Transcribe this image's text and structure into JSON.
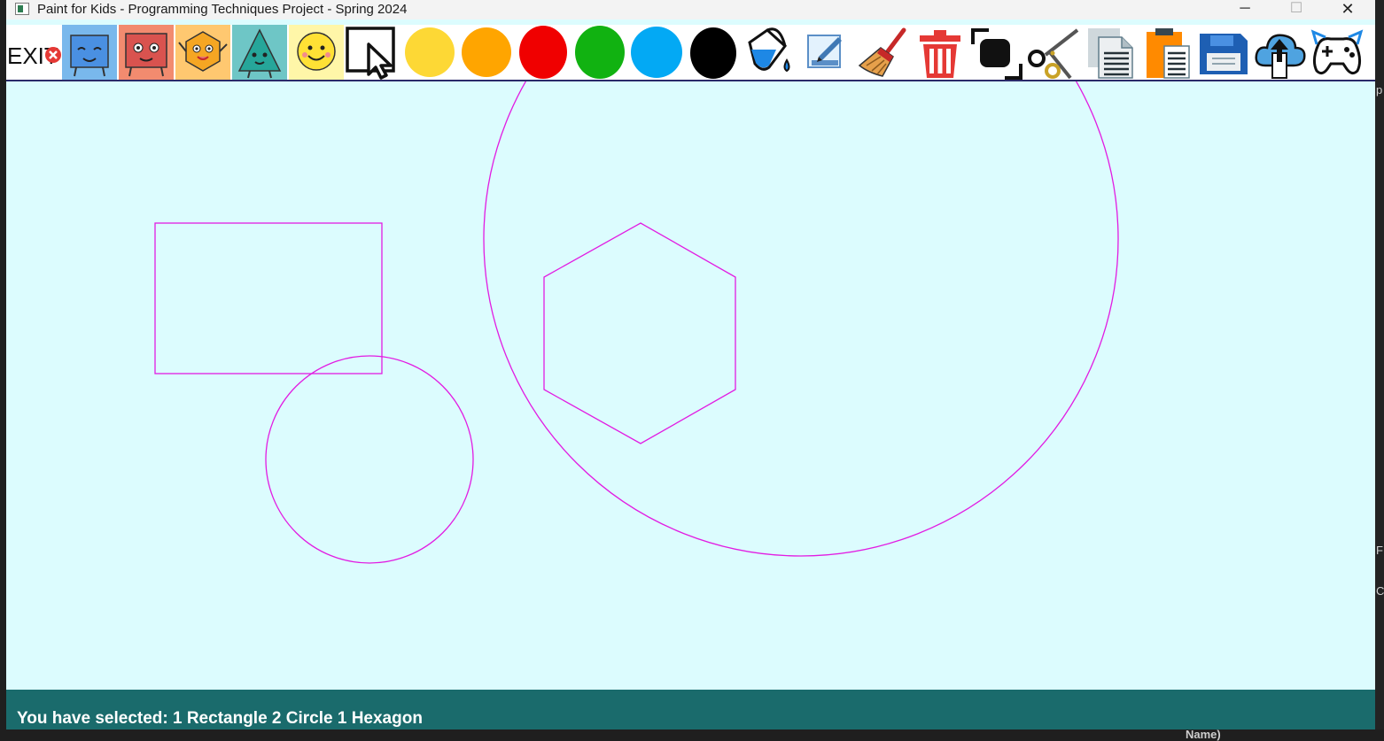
{
  "window": {
    "title": "Paint for Kids - Programming Techniques Project - Spring 2024",
    "minimize_glyph": "─",
    "maximize_glyph": "☐",
    "close_glyph": "✕"
  },
  "toolbar": {
    "exit_label": "EXIT",
    "items": [
      {
        "name": "exit",
        "icon": "exit-icon"
      },
      {
        "name": "square",
        "icon": "square-character-icon"
      },
      {
        "name": "rectangle",
        "icon": "rectangle-character-icon"
      },
      {
        "name": "hexagon",
        "icon": "hexagon-character-icon"
      },
      {
        "name": "triangle",
        "icon": "triangle-character-icon"
      },
      {
        "name": "circle",
        "icon": "circle-character-icon"
      },
      {
        "name": "select",
        "icon": "cursor-icon"
      },
      {
        "name": "yellow",
        "icon": "yellow-color-icon",
        "color": "#fdd835"
      },
      {
        "name": "orange",
        "icon": "orange-color-icon",
        "color": "#ffa500"
      },
      {
        "name": "red",
        "icon": "red-color-icon",
        "color": "#f00000"
      },
      {
        "name": "green",
        "icon": "green-color-icon",
        "color": "#11b211"
      },
      {
        "name": "blue",
        "icon": "blue-color-icon",
        "color": "#03a9f4"
      },
      {
        "name": "black",
        "icon": "black-color-icon",
        "color": "#000000"
      },
      {
        "name": "fill",
        "icon": "paint-bucket-icon"
      },
      {
        "name": "edit",
        "icon": "edit-pencil-icon"
      },
      {
        "name": "clear",
        "icon": "broom-icon"
      },
      {
        "name": "delete",
        "icon": "trash-icon"
      },
      {
        "name": "copy",
        "icon": "copy-icon"
      },
      {
        "name": "cut",
        "icon": "scissors-icon"
      },
      {
        "name": "paste",
        "icon": "document-icon"
      },
      {
        "name": "clipboard",
        "icon": "clipboard-icon"
      },
      {
        "name": "save",
        "icon": "floppy-disk-icon"
      },
      {
        "name": "load",
        "icon": "cloud-upload-icon"
      },
      {
        "name": "play",
        "icon": "gamepad-icon"
      }
    ]
  },
  "canvas": {
    "background": "#dcfcfe",
    "shape_color": "#e21be2",
    "shapes": [
      {
        "type": "rectangle"
      },
      {
        "type": "circle"
      },
      {
        "type": "circle"
      },
      {
        "type": "hexagon"
      }
    ]
  },
  "status": {
    "text": "You have selected: 1  Rectangle 2  Circle 1  Hexagon"
  },
  "background_window": {
    "bottom_text": "Name)",
    "side_chars": [
      "p",
      "F",
      "C"
    ]
  }
}
